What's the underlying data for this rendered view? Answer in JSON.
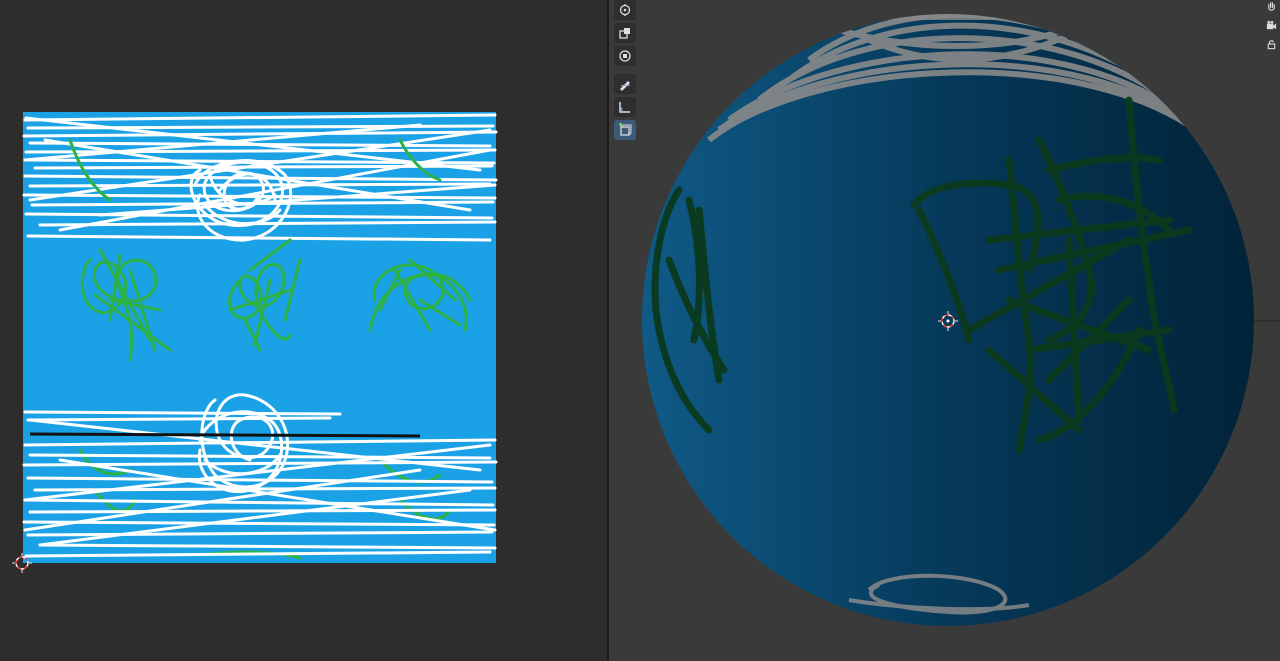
{
  "colors": {
    "uv_background": "#2d2d2d",
    "viewport_background": "#3a3a3a",
    "texture_sky": "#1ba2e6",
    "paint_white": "#ffffff",
    "paint_green": "#2db044",
    "paint_black": "#111111",
    "sphere_dark": "#002a45",
    "sphere_mid": "#0a4f78",
    "sphere_green": "#0b3a1c",
    "cursor_red": "#e8453c"
  },
  "uv_editor": {
    "texture": "painted-image",
    "cursor_icon": "2d-cursor-icon"
  },
  "viewport": {
    "object": "uv-sphere",
    "cursor_icon": "3d-cursor-icon",
    "tools": [
      {
        "name": "rotate-icon"
      },
      {
        "name": "scale-icon"
      },
      {
        "name": "transform-icon"
      },
      {
        "name": "annotate-icon"
      },
      {
        "name": "measure-icon"
      },
      {
        "name": "add-cube-icon"
      }
    ],
    "navigation": [
      {
        "name": "hand-pan-icon"
      },
      {
        "name": "camera-icon"
      },
      {
        "name": "lock-icon"
      }
    ]
  }
}
